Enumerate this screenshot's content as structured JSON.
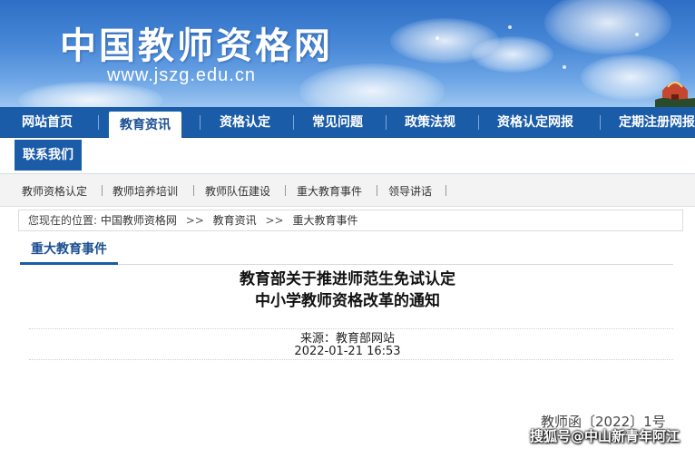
{
  "header": {
    "site_title": "中国教师资格网",
    "site_url": "www.jszg.edu.cn"
  },
  "main_nav": {
    "items": [
      {
        "label": "网站首页"
      },
      {
        "label": "教育资讯",
        "active": true
      },
      {
        "label": "资格认定"
      },
      {
        "label": "常见问题"
      },
      {
        "label": "政策法规"
      },
      {
        "label": "资格认定网报"
      },
      {
        "label": "定期注册网报"
      }
    ],
    "contact": "联系我们"
  },
  "sub_nav": {
    "items": [
      {
        "label": "教师资格认定"
      },
      {
        "label": "教师培养培训"
      },
      {
        "label": "教师队伍建设"
      },
      {
        "label": "重大教育事件"
      },
      {
        "label": "领导讲话"
      }
    ]
  },
  "breadcrumb": {
    "prefix": "您现在的位置:",
    "items": [
      {
        "label": "中国教师资格网"
      },
      {
        "label": "教育资讯"
      },
      {
        "label": "重大教育事件"
      }
    ],
    "separator": ">>"
  },
  "section": {
    "title": "重大教育事件"
  },
  "article": {
    "title_line1": "教育部关于推进师范生免试认定",
    "title_line2": "中小学教师资格改革的通知",
    "source": "来源：教育部网站",
    "date": "2022-01-21 16:53",
    "doc_number": "教师函〔2022〕1号"
  },
  "watermark": "搜狐号@中山新青年阿江",
  "colors": {
    "nav_blue": "#1b5ca8",
    "active_text": "#1b4f91",
    "subnav_bg": "#f3f3f3"
  }
}
